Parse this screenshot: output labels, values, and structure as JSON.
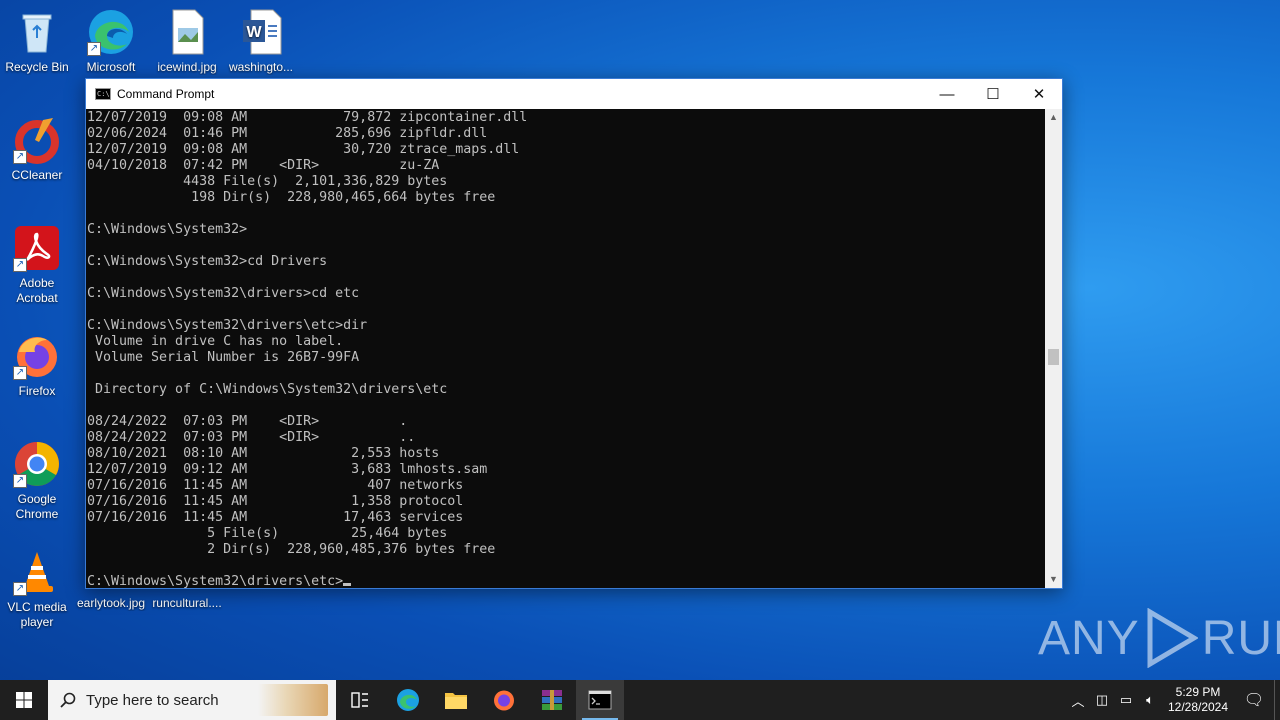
{
  "desktop": {
    "icons": [
      {
        "name": "recycle-bin",
        "label": "Recycle Bin"
      },
      {
        "name": "microsoft-edge",
        "label": "Microsoft Edge"
      },
      {
        "name": "icewind",
        "label": "icewind.jpg"
      },
      {
        "name": "washington",
        "label": "washingto..."
      },
      {
        "name": "ccleaner",
        "label": "CCleaner"
      },
      {
        "name": "adobe-acrobat",
        "label": "Adobe Acrobat"
      },
      {
        "name": "firefox",
        "label": "Firefox"
      },
      {
        "name": "google-chrome",
        "label": "Google Chrome"
      },
      {
        "name": "vlc",
        "label": "VLC media player"
      },
      {
        "name": "earlytook",
        "label": "earlytook.jpg"
      },
      {
        "name": "runcultural",
        "label": "runcultural...."
      }
    ]
  },
  "window": {
    "title": "Command Prompt",
    "icon_text": "C:\\",
    "minimize": "—",
    "maximize": "☐",
    "close": "✕"
  },
  "console": {
    "lines": [
      "12/07/2019  09:08 AM            79,872 zipcontainer.dll",
      "02/06/2024  01:46 PM           285,696 zipfldr.dll",
      "12/07/2019  09:08 AM            30,720 ztrace_maps.dll",
      "04/10/2018  07:42 PM    <DIR>          zu-ZA",
      "            4438 File(s)  2,101,336,829 bytes",
      "             198 Dir(s)  228,980,465,664 bytes free",
      "",
      "C:\\Windows\\System32>",
      "",
      "C:\\Windows\\System32>cd Drivers",
      "",
      "C:\\Windows\\System32\\drivers>cd etc",
      "",
      "C:\\Windows\\System32\\drivers\\etc>dir",
      " Volume in drive C has no label.",
      " Volume Serial Number is 26B7-99FA",
      "",
      " Directory of C:\\Windows\\System32\\drivers\\etc",
      "",
      "08/24/2022  07:03 PM    <DIR>          .",
      "08/24/2022  07:03 PM    <DIR>          ..",
      "08/10/2021  08:10 AM             2,553 hosts",
      "12/07/2019  09:12 AM             3,683 lmhosts.sam",
      "07/16/2016  11:45 AM               407 networks",
      "07/16/2016  11:45 AM             1,358 protocol",
      "07/16/2016  11:45 AM            17,463 services",
      "               5 File(s)         25,464 bytes",
      "               2 Dir(s)  228,960,485,376 bytes free",
      ""
    ],
    "prompt": "C:\\Windows\\System32\\drivers\\etc>"
  },
  "watermark": {
    "left": "ANY",
    "right": "RUN"
  },
  "taskbar": {
    "search_placeholder": "Type here to search",
    "time": "5:29 PM",
    "date": "12/28/2024"
  },
  "colors": {
    "console_bg": "#0c0c0c",
    "console_fg": "#c0c0c0",
    "taskbar_bg": "#1f1f1f",
    "accent": "#76b9ed"
  }
}
